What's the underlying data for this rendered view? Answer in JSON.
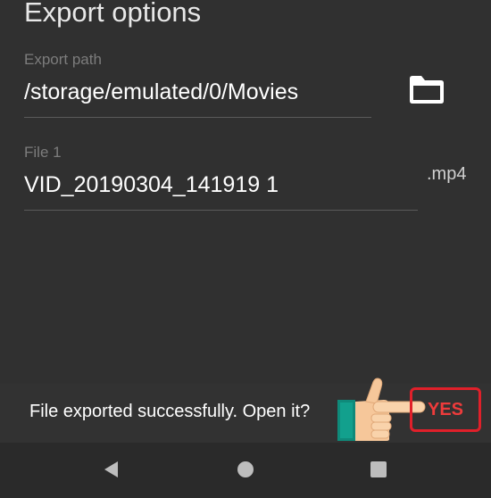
{
  "dialog": {
    "title": "Export options",
    "export_path": {
      "label": "Export path",
      "value": "/storage/emulated/0/Movies"
    },
    "file": {
      "label": "File 1",
      "value": "VID_20190304_141919 1",
      "extension": ".mp4"
    }
  },
  "snackbar": {
    "message": "File exported successfully. Open it?",
    "action_label": "YES",
    "action_highlight_color": "#e0202a"
  },
  "icons": {
    "folder": "folder-icon",
    "pointer": "pointing-hand-icon",
    "nav_back": "back-triangle-icon",
    "nav_home": "home-circle-icon",
    "nav_recents": "recents-square-icon"
  }
}
